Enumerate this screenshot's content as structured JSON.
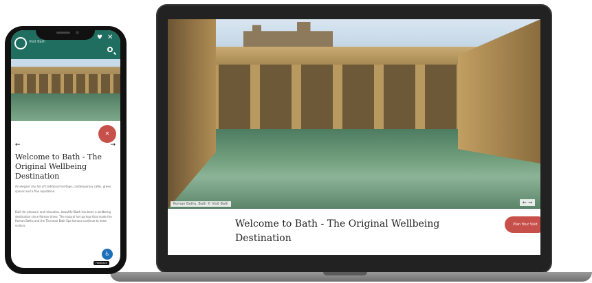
{
  "laptop": {
    "title": "Welcome to Bath - The Original Wellbeing Destination",
    "hero_caption": "Roman Baths, Bath © Visit Bath",
    "slider_arrows": "← →",
    "cta_label": "Plan Your Visit",
    "accent_color": "#c8504b"
  },
  "phone": {
    "logo_text": "Visit Bath",
    "header_color": "#1f6e60",
    "arrow_left": "←",
    "arrow_right": "→",
    "title": "Welcome to Bath - The Original Wellbeing Destination",
    "fab_icon": "✕",
    "paragraph1": "An elegant city full of traditional heritage, contemporary cafés, green spaces and a fine reputation.",
    "paragraph2": "Built for pleasure and relaxation, beautiful Bath has been a wellbeing destination since Roman times. The natural hot springs that made the Roman Baths and the Thermae Bath Spa famous continue to draw visitors.",
    "access_icon": "accessibility-icon",
    "badge": "Feedback"
  }
}
